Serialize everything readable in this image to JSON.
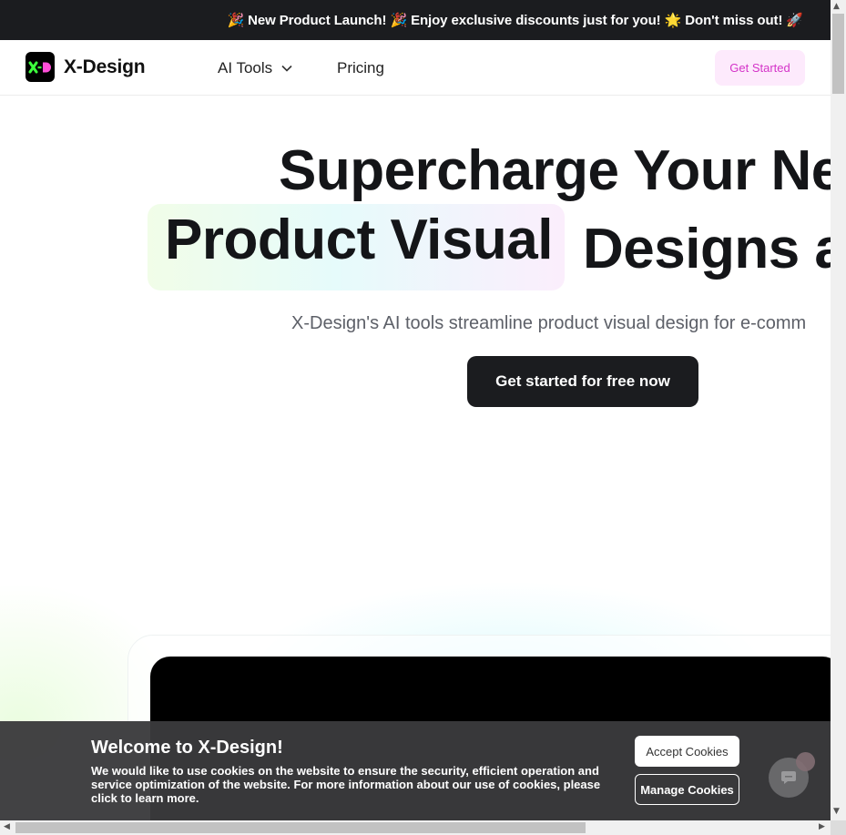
{
  "announcement": {
    "text": "🎉 New Product Launch! 🎉 Enjoy exclusive discounts just for you! 🌟 Don't miss out! 🚀"
  },
  "header": {
    "brand": "X-Design",
    "nav": {
      "ai_tools": "AI Tools",
      "pricing": "Pricing"
    },
    "get_started": "Get Started"
  },
  "hero": {
    "line1": "Supercharge Your Ne",
    "highlight": "Product Visual",
    "line2_rest": "Designs a",
    "subtitle": "X-Design's AI tools streamline product visual design for e-comm",
    "cta": "Get started for free now"
  },
  "cookie": {
    "title": "Welcome to X-Design!",
    "body": "We would like to use cookies on the website to ensure the security, efficient operation and service optimization of the website. For more information about our use of cookies, please click to learn more.",
    "accept": "Accept Cookies",
    "manage": "Manage Cookies"
  },
  "colors": {
    "dark": "#1b1c1f",
    "accent_pink": "#d433c8",
    "logo_green": "#3cff3c",
    "logo_pink": "#ff4fd8"
  },
  "icons": {
    "dropdown": "chevron-down-icon",
    "chat": "chat-icon"
  }
}
